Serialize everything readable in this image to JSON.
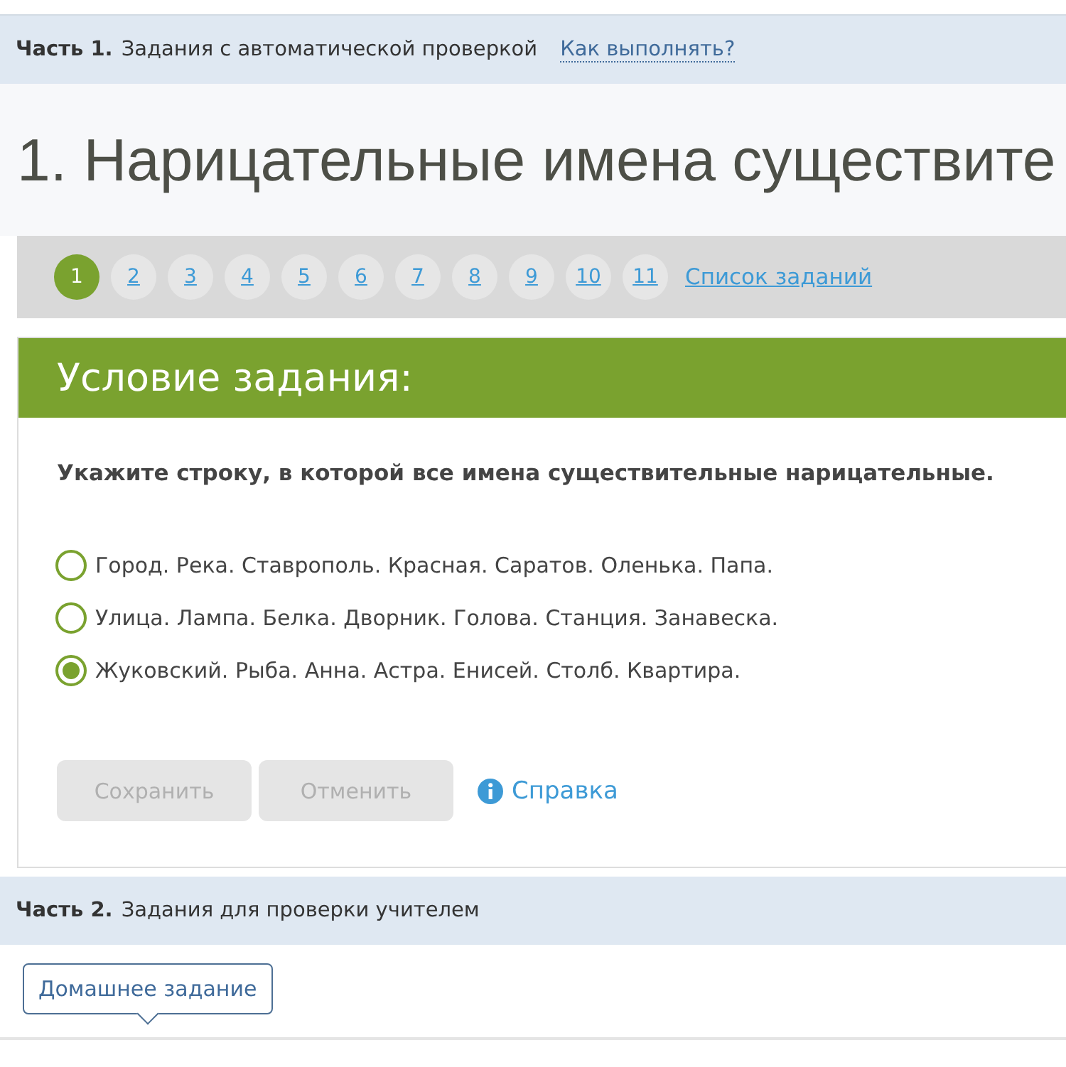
{
  "part1": {
    "label": "Часть 1.",
    "text": "Задания с автоматической проверкой",
    "link": "Как выполнять?"
  },
  "title": "1. Нарицательные имена существите",
  "pagination": {
    "pages": [
      {
        "label": "1",
        "selected": true
      },
      {
        "label": "2",
        "selected": false
      },
      {
        "label": "3",
        "selected": false
      },
      {
        "label": "4",
        "selected": false
      },
      {
        "label": "5",
        "selected": false
      },
      {
        "label": "6",
        "selected": false
      },
      {
        "label": "7",
        "selected": false
      },
      {
        "label": "8",
        "selected": false
      },
      {
        "label": "9",
        "selected": false
      },
      {
        "label": "10",
        "selected": false
      },
      {
        "label": "11",
        "selected": false
      }
    ],
    "list_link": "Список заданий"
  },
  "card": {
    "header": "Условие задания:",
    "question": "Укажите строку, в которой все имена существительные нарицательные.",
    "options": [
      {
        "text": "Город. Река. Ставрополь. Красная. Саратов. Оленька. Папа.",
        "selected": false
      },
      {
        "text": "Улица. Лампа. Белка. Дворник. Голова. Станция. Занавеска.",
        "selected": false
      },
      {
        "text": "Жуковский. Рыба. Анна. Астра. Енисей. Столб. Квартира.",
        "selected": true
      }
    ],
    "buttons": [
      {
        "label": "Сохранить",
        "disabled": true
      },
      {
        "label": "Отменить",
        "disabled": true
      }
    ],
    "help_link": "Справка"
  },
  "part2": {
    "label": "Часть 2.",
    "text": "Задания для проверки учителем"
  },
  "homework_tab": "Домашнее задание"
}
